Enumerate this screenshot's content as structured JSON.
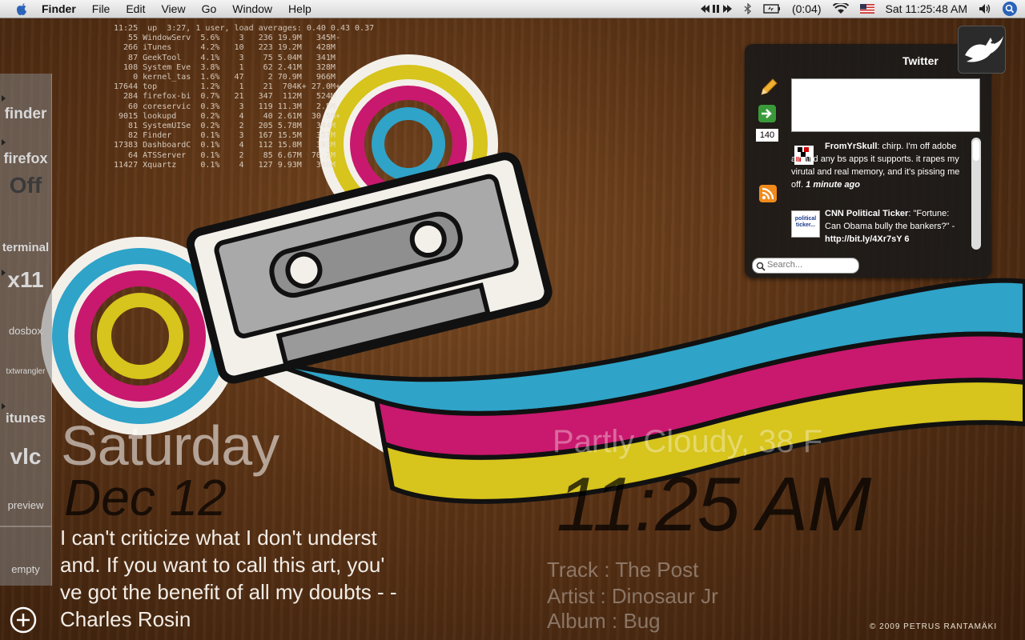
{
  "menubar": {
    "app_name": "Finder",
    "menus": [
      "File",
      "Edit",
      "View",
      "Go",
      "Window",
      "Help"
    ],
    "battery": "(0:04)",
    "clock": "Sat 11:25:48 AM"
  },
  "top_output": "11:25  up  3:27, 1 user, load averages: 0.40 0.43 0.37\n   55 WindowServ  5.6%    3   236 19.9M   345M-\n  266 iTunes      4.2%   10   223 19.2M   428M\n   87 GeekTool    4.1%    3    75 5.04M   341M\n  108 System Eve  3.8%    1    62 2.41M   328M\n    0 kernel_tas  1.6%   47     2 70.9M   966M\n17644 top         1.2%    1    21  704K+ 27.0M+\n  284 firefox-bi  0.7%   21   347  112M   524M\n   60 coreservic  0.3%    3   119 11.3M   2.5M\n 9015 lookupd     0.2%    4    40 2.61M  30.5M+\n   81 SystemUISe  0.2%    2   205 5.78M   344M\n   82 Finder      0.1%    3   167 15.5M   357M\n17383 DashboardC  0.1%    4   112 15.8M   393M\n   64 ATSServer   0.1%    2    85 6.67M  70.2M\n11427 Xquartz     0.1%    4   127 9.93M   346M",
  "dock": {
    "items": [
      {
        "label": "finder"
      },
      {
        "label": "firefox"
      },
      {
        "label": "Off"
      },
      {
        "label": "terminal"
      },
      {
        "label": "x11"
      },
      {
        "label": "dosbox"
      },
      {
        "label": "txtwrangler"
      },
      {
        "label": "itunes"
      },
      {
        "label": "vlc"
      },
      {
        "label": "preview"
      },
      {
        "label": "empty"
      }
    ]
  },
  "desktop": {
    "day": "Saturday",
    "date": "Dec 12",
    "quote": "I can't criticize what I don't underst and. If you want to call this art, you' ve got the benefit of all my doubts - - Charles Rosin",
    "weather": "Partly Cloudy, 38 F",
    "time": "11:25 AM",
    "track": "Track  : The Post",
    "artist": "Artist : Dinosaur Jr",
    "album": "Album  : Bug",
    "credit": "© 2009 PETRUS RANTAMÄKI"
  },
  "twitter": {
    "title": "Twitter",
    "char_count": "140",
    "search_placeholder": "Search...",
    "tweets": [
      {
        "user": "FromYrSkull",
        "text": ": chirp. I'm off adobe air and any bs apps it supports. it rapes my virutal and real memory, and it's pissing me off.",
        "time": "1 minute ago"
      },
      {
        "user": "CNN Political Ticker",
        "text": ": \"Fortune: Can Obama bully the bankers?\" - ",
        "link": "http://bit.ly/4Xr7sY 6",
        "avatar_text": "political ticker..."
      }
    ]
  },
  "colors": {
    "cyan": "#2fa3c8",
    "magenta": "#c8196e",
    "yellow": "#d7c41c"
  }
}
